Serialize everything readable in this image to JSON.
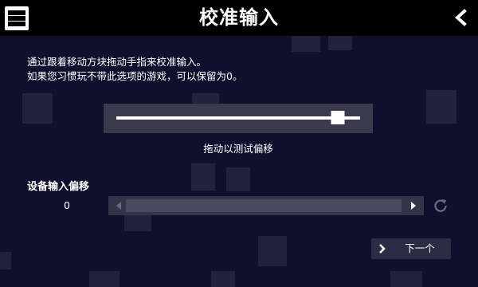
{
  "header": {
    "title": "校准输入",
    "logo_icon": "s-logo-icon",
    "back_icon": "chevron-left-icon"
  },
  "description": {
    "line1": "通过跟着移动方块拖动手指来校准输入。",
    "line2": "如果您习惯玩不带此选项的游戏，可以保留为0。"
  },
  "calibration": {
    "caption": "拖动以测试偏移",
    "thumb_position_percent": 91
  },
  "offset": {
    "label": "设备输入偏移",
    "value": "0",
    "left_icon": "arrow-left-icon",
    "right_icon": "arrow-right-icon",
    "reset_icon": "reset-icon"
  },
  "next": {
    "label": "下一个",
    "icon": "chevron-right-icon"
  },
  "colors": {
    "background": "#100f2e",
    "header": "#000000",
    "panel": "#3a3a4c",
    "accent": "#ffffff"
  }
}
